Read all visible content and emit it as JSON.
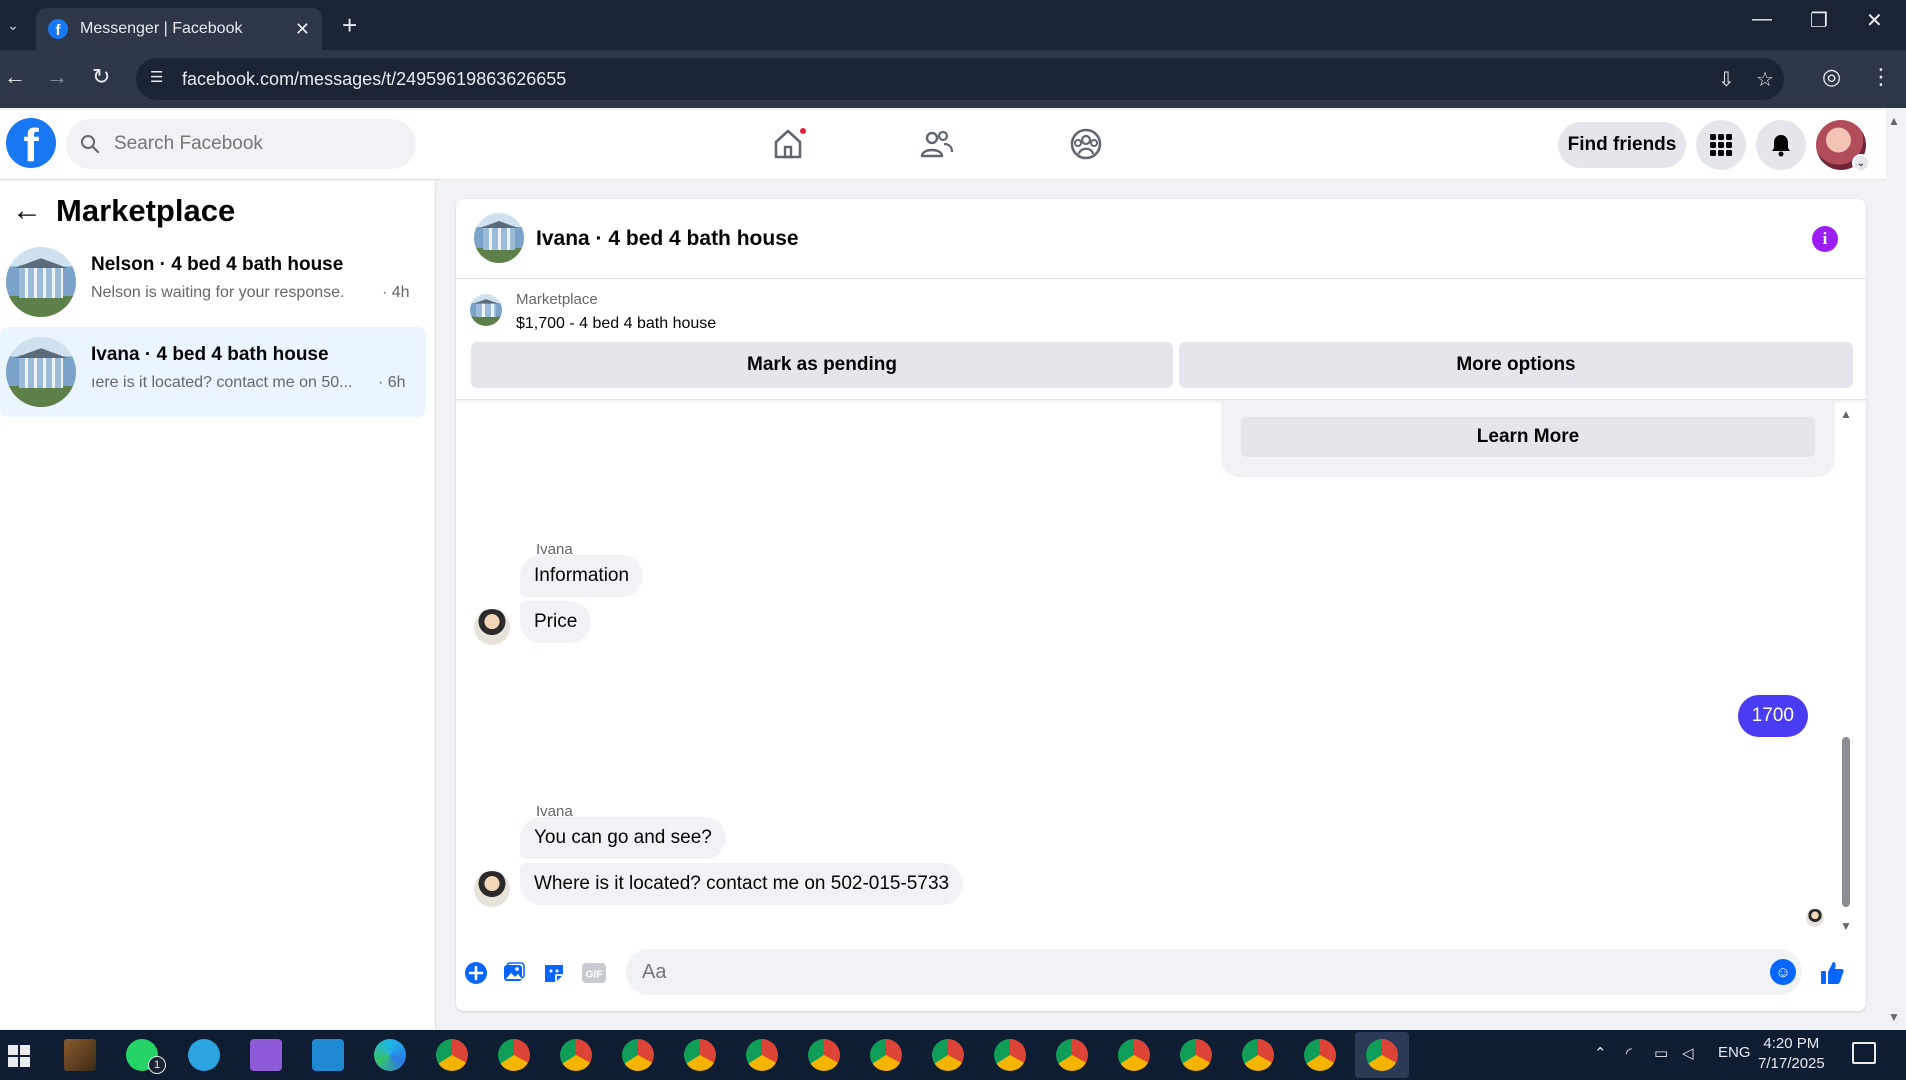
{
  "browser": {
    "tab_title": "Messenger | Facebook",
    "url": "facebook.com/messages/t/24959619863626655"
  },
  "fb": {
    "search_placeholder": "Search Facebook",
    "find_friends": "Find friends",
    "accent": "#1877f2",
    "home_notification": true
  },
  "sidebar": {
    "title": "Marketplace",
    "conversations": [
      {
        "name": "Nelson · 4 bed 4 bath house",
        "preview": "Nelson is waiting for your response.",
        "time": "· 4h",
        "active": false
      },
      {
        "name": "Ivana · 4 bed 4 bath house",
        "preview": "ıere is it located? contact me on 50...",
        "time": "· 6h",
        "active": true
      }
    ]
  },
  "chat": {
    "title": "Ivana · 4 bed 4 bath house",
    "marketplace_label": "Marketplace",
    "listing": "$1,700 - 4 bed 4 bath house",
    "mark_pending": "Mark as pending",
    "more_options": "More options",
    "learn_more": "Learn More",
    "messages": [
      {
        "sender": "Ivana",
        "text": "Information"
      },
      {
        "text": "Price"
      },
      {
        "text": "1700",
        "outgoing": true
      },
      {
        "sender": "Ivana",
        "text": "You can go and see?"
      },
      {
        "text": "Where is it located? contact me on 502-015-5733"
      }
    ],
    "composer_placeholder": "Aa",
    "outgoing_color": "#4a3cf3"
  },
  "taskbar": {
    "language": "ENG",
    "time": "4:20 PM",
    "date": "7/17/2025",
    "whatsapp_badge": "1"
  }
}
